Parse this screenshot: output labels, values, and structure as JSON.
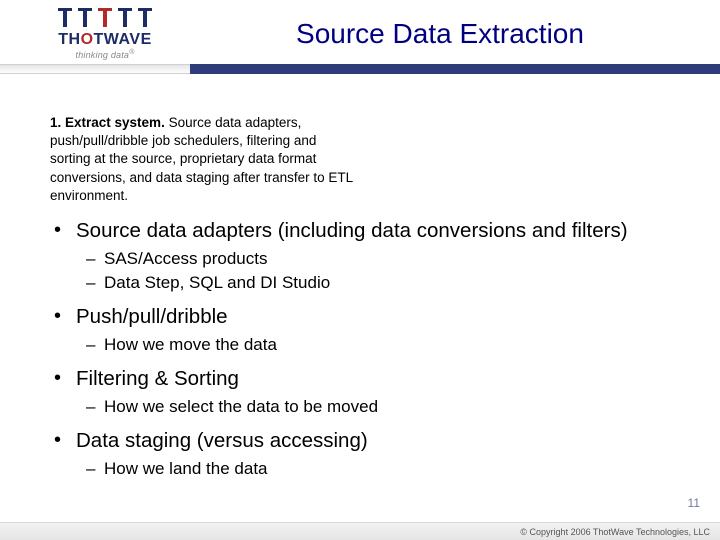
{
  "header": {
    "title": "Source Data Extraction",
    "logo": {
      "name_parts": [
        "TH",
        "O",
        "TWAVE"
      ],
      "tagline": "thinking data",
      "trademark": "®"
    }
  },
  "extract_box": {
    "lead": "1. Extract system.",
    "body": " Source data adapters, push/pull/dribble job schedulers, filtering and sorting at the source, proprietary data format conversions, and data staging after transfer to ETL environment."
  },
  "bullets": [
    {
      "text": "Source data adapters (including data conversions and filters)",
      "sub": [
        "SAS/Access products",
        "Data Step, SQL and DI Studio"
      ]
    },
    {
      "text": "Push/pull/dribble",
      "sub": [
        "How we move the data"
      ]
    },
    {
      "text": "Filtering & Sorting",
      "sub": [
        "How we select the data to be moved"
      ]
    },
    {
      "text": "Data staging (versus accessing)",
      "sub": [
        "How we land the data"
      ]
    }
  ],
  "page_number": "11",
  "footer": {
    "copyright_symbol": "©",
    "text": "Copyright 2006 ThotWave Technologies, LLC"
  }
}
